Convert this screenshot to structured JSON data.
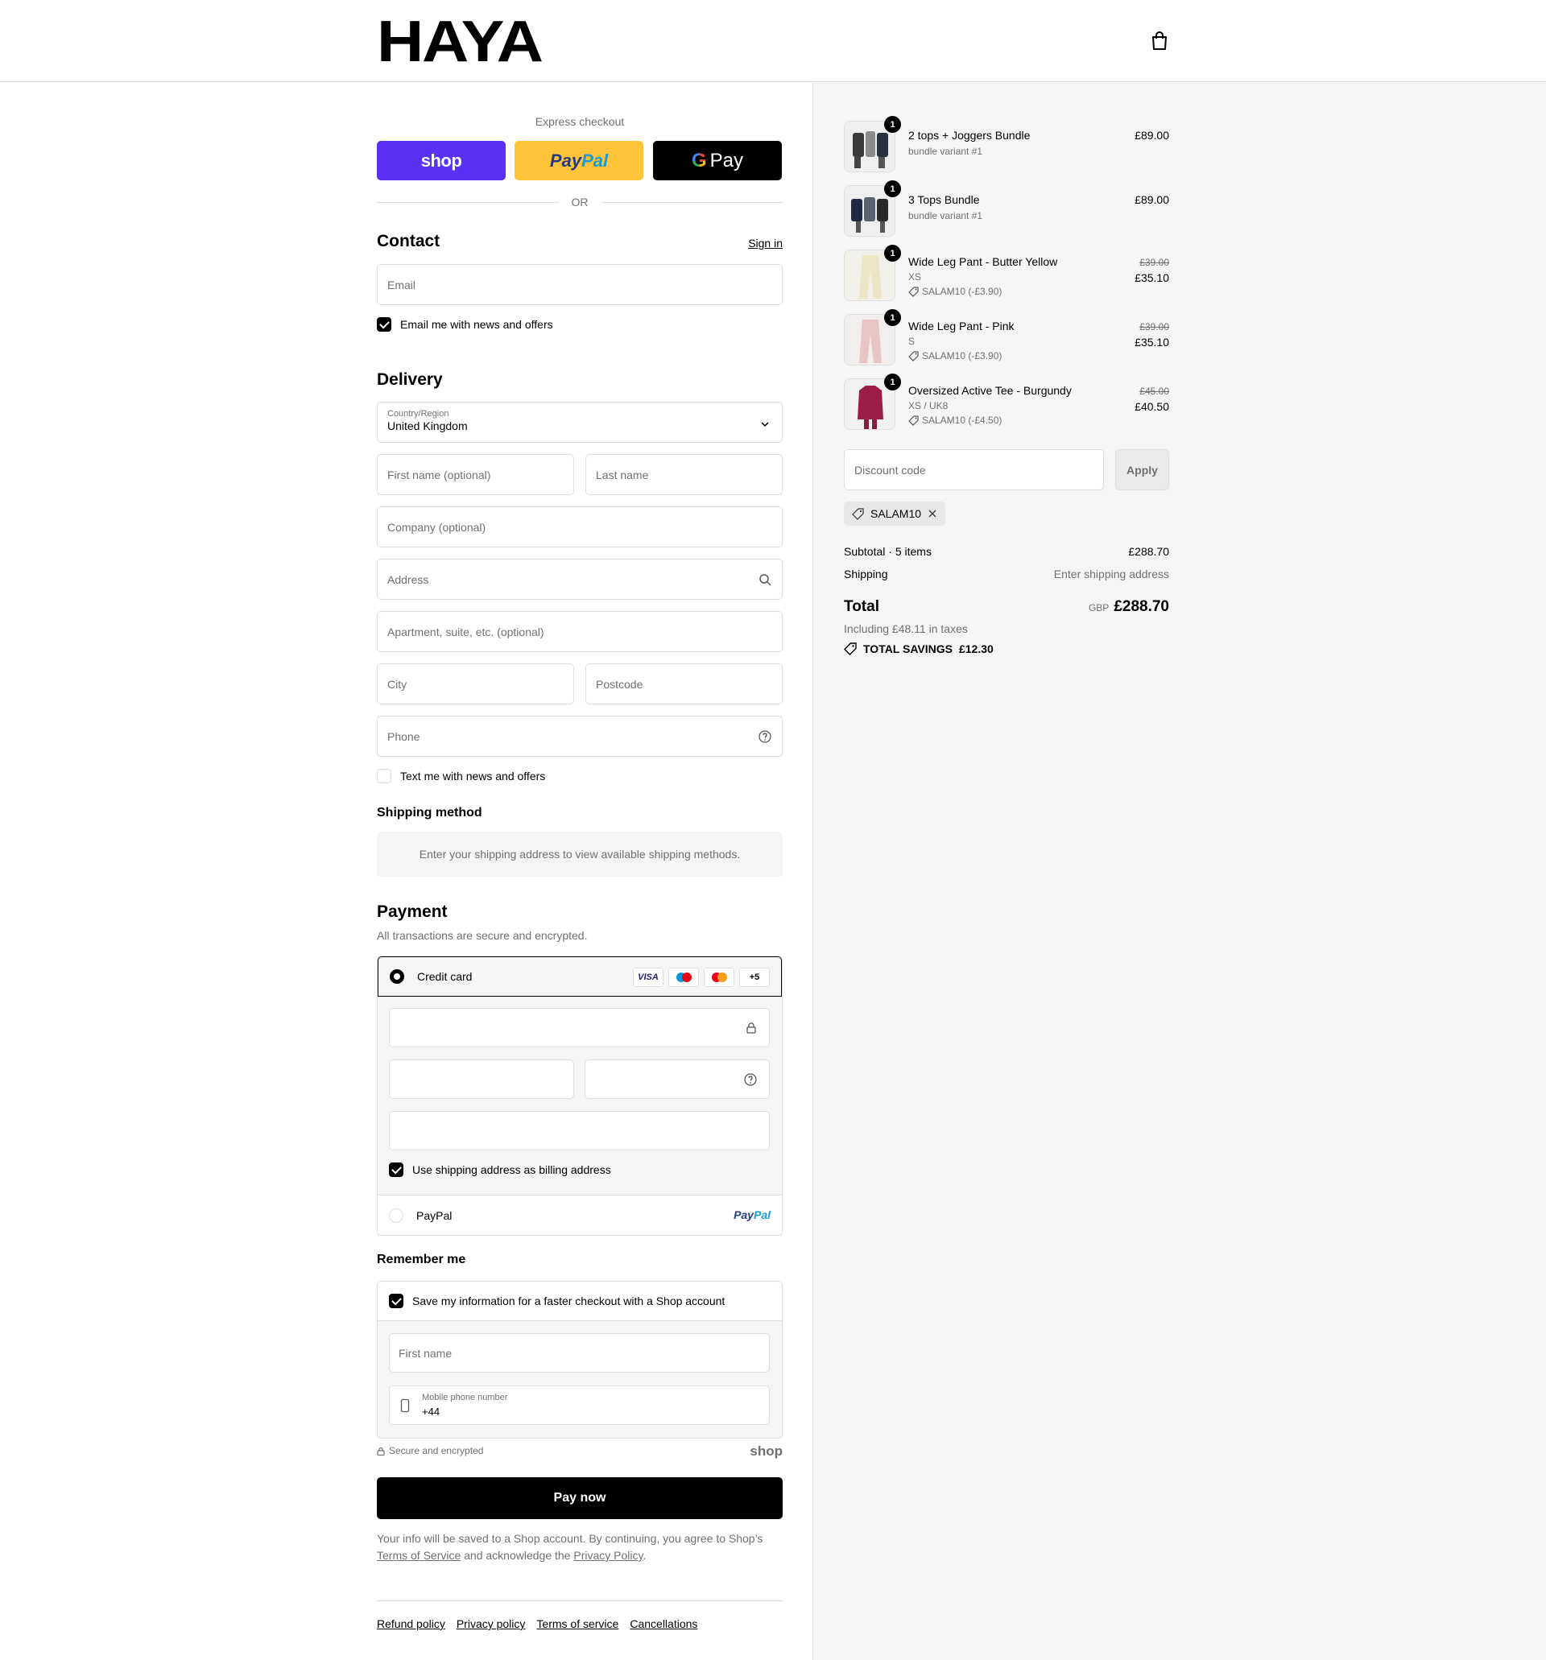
{
  "brand": {
    "logo": "HAYA"
  },
  "express": {
    "label": "Express checkout",
    "shop": "shop",
    "paypal_a": "Pay",
    "paypal_b": "Pal",
    "gpay_g": "G",
    "gpay": "Pay",
    "or": "OR"
  },
  "contact": {
    "title": "Contact",
    "sign_in": "Sign in",
    "email_placeholder": "Email",
    "news_label": "Email me with news and offers",
    "news_checked": true
  },
  "delivery": {
    "title": "Delivery",
    "country_label": "Country/Region",
    "country_value": "United Kingdom",
    "first_name": "First name (optional)",
    "last_name": "Last name",
    "company": "Company (optional)",
    "address": "Address",
    "apartment": "Apartment, suite, etc. (optional)",
    "city": "City",
    "postcode": "Postcode",
    "phone": "Phone",
    "text_label": "Text me with news and offers"
  },
  "shipping_method": {
    "title": "Shipping method",
    "note": "Enter your shipping address to view available shipping methods."
  },
  "payment": {
    "title": "Payment",
    "subtitle": "All transactions are secure and encrypted.",
    "credit_card": "Credit card",
    "cards": [
      "VISA",
      "maestro",
      "mastercard",
      "+5"
    ],
    "billing_label": "Use shipping address as billing address",
    "paypal_option": "PayPal",
    "paypal_logo_a": "Pay",
    "paypal_logo_b": "Pal"
  },
  "remember": {
    "title": "Remember me",
    "save_label": "Save my information for a faster checkout with a Shop account",
    "first_name": "First name",
    "mobile_label": "Mobile phone number",
    "mobile_value": "+44",
    "secure": "Secure and encrypted",
    "shop": "shop"
  },
  "pay_now": "Pay now",
  "legal": {
    "pre": "Your info will be saved to a Shop account. By continuing, you agree to Shop’s ",
    "tos": "Terms of Service",
    "mid": " and acknowledge the ",
    "privacy": "Privacy Policy",
    "post": "."
  },
  "footer_links": [
    "Refund policy",
    "Privacy policy",
    "Terms of service",
    "Cancellations"
  ],
  "cart": {
    "items": [
      {
        "name": "2 tops + Joggers Bundle",
        "variant": "bundle variant #1",
        "qty": "1",
        "price": "£89.00"
      },
      {
        "name": "3 Tops Bundle",
        "variant": "bundle variant #1",
        "qty": "1",
        "price": "£89.00"
      },
      {
        "name": "Wide Leg Pant - Butter Yellow",
        "variant": "XS",
        "qty": "1",
        "discount": "SALAM10 (-£3.90)",
        "original": "£39.00",
        "price": "£35.10"
      },
      {
        "name": "Wide Leg Pant - Pink",
        "variant": "S",
        "qty": "1",
        "discount": "SALAM10 (-£3.90)",
        "original": "£39.00",
        "price": "£35.10"
      },
      {
        "name": "Oversized Active Tee - Burgundy",
        "variant": "XS / UK8",
        "qty": "1",
        "discount": "SALAM10 (-£4.50)",
        "original": "£45.00",
        "price": "£40.50"
      }
    ],
    "discount_placeholder": "Discount code",
    "apply": "Apply",
    "applied_code": "SALAM10",
    "subtotal_label": "Subtotal · 5 items",
    "subtotal": "£288.70",
    "shipping_label": "Shipping",
    "shipping_value": "Enter shipping address",
    "total_label": "Total",
    "currency": "GBP",
    "total": "£288.70",
    "taxes": "Including £48.11 in taxes",
    "savings_label": "TOTAL SAVINGS",
    "savings": "£12.30"
  }
}
